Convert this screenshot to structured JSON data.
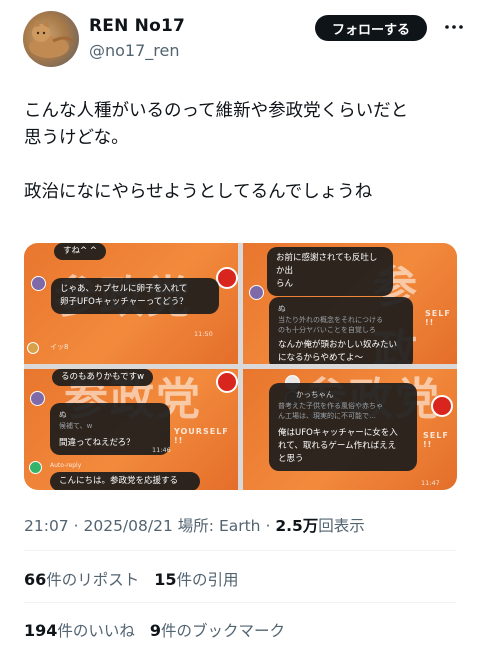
{
  "user": {
    "display_name": "REN No17",
    "handle": "@no17_ren",
    "follow_label": "フォローする"
  },
  "tweet": {
    "lines": [
      "こんな人種がいるのって維新や参政党くらいだと",
      "思うけどな。",
      "",
      "政治になにやらせようとしてるんでしょうね"
    ]
  },
  "media": {
    "images": [
      {
        "banner": "参政党",
        "messages": [
          {
            "text": "すね^ ^"
          },
          {
            "text": "じゃあ、カプセルに卵子を入れて\n卵子UFOキャッチャーってどう？"
          },
          {
            "text": "るのもありかもですw"
          }
        ],
        "time": "11:50",
        "user": "イッ8"
      },
      {
        "banner": "参政党",
        "messages": [
          {
            "text": "お前に感謝されても反吐しか出\nらん"
          },
          {
            "name": "ぬ",
            "sub": "当たり外れの概念をそれにつける\nのも十分ヤバいことを自覚しろ"
          },
          {
            "text": "なんか俺が頭おかしい奴みたい\nになるからやめてよ〜"
          }
        ],
        "tag": "SELF !!"
      },
      {
        "banner": "参政党",
        "messages": [
          {
            "text": "るのもありかもですw"
          },
          {
            "name": "ぬ",
            "sub": "候補て、w"
          },
          {
            "text": "間違ってねえだろ？"
          },
          {
            "text": "こんにちは。参政党を応援する"
          }
        ],
        "tag": "YOURSELF !!",
        "time": "11:46",
        "auto_reply": "Auto-reply"
      },
      {
        "banner": "参政党",
        "messages": [
          {
            "name": "かっちゃん",
            "sub": "普考えた子供を作る風俗や赤ちゃ\nん工場は、現実的に不可能で…"
          },
          {
            "text": "俺はUFOキャッチャーに女を入\nれて、取れるゲーム作ればええ\nと思う"
          }
        ],
        "tag": "SELF !!",
        "time": "11:47"
      }
    ]
  },
  "meta": {
    "time": "21:07",
    "date": "2025/08/21",
    "location_label": "場所:",
    "location": "Earth",
    "sep": "·",
    "views": "2.5万",
    "views_label": "回表示"
  },
  "stats": {
    "reposts": "66",
    "reposts_label": "件のリポスト",
    "quotes": "15",
    "quotes_label": "件の引用",
    "likes": "194",
    "likes_label": "件のいいね",
    "bookmarks": "9",
    "bookmarks_label": "件のブックマーク"
  }
}
